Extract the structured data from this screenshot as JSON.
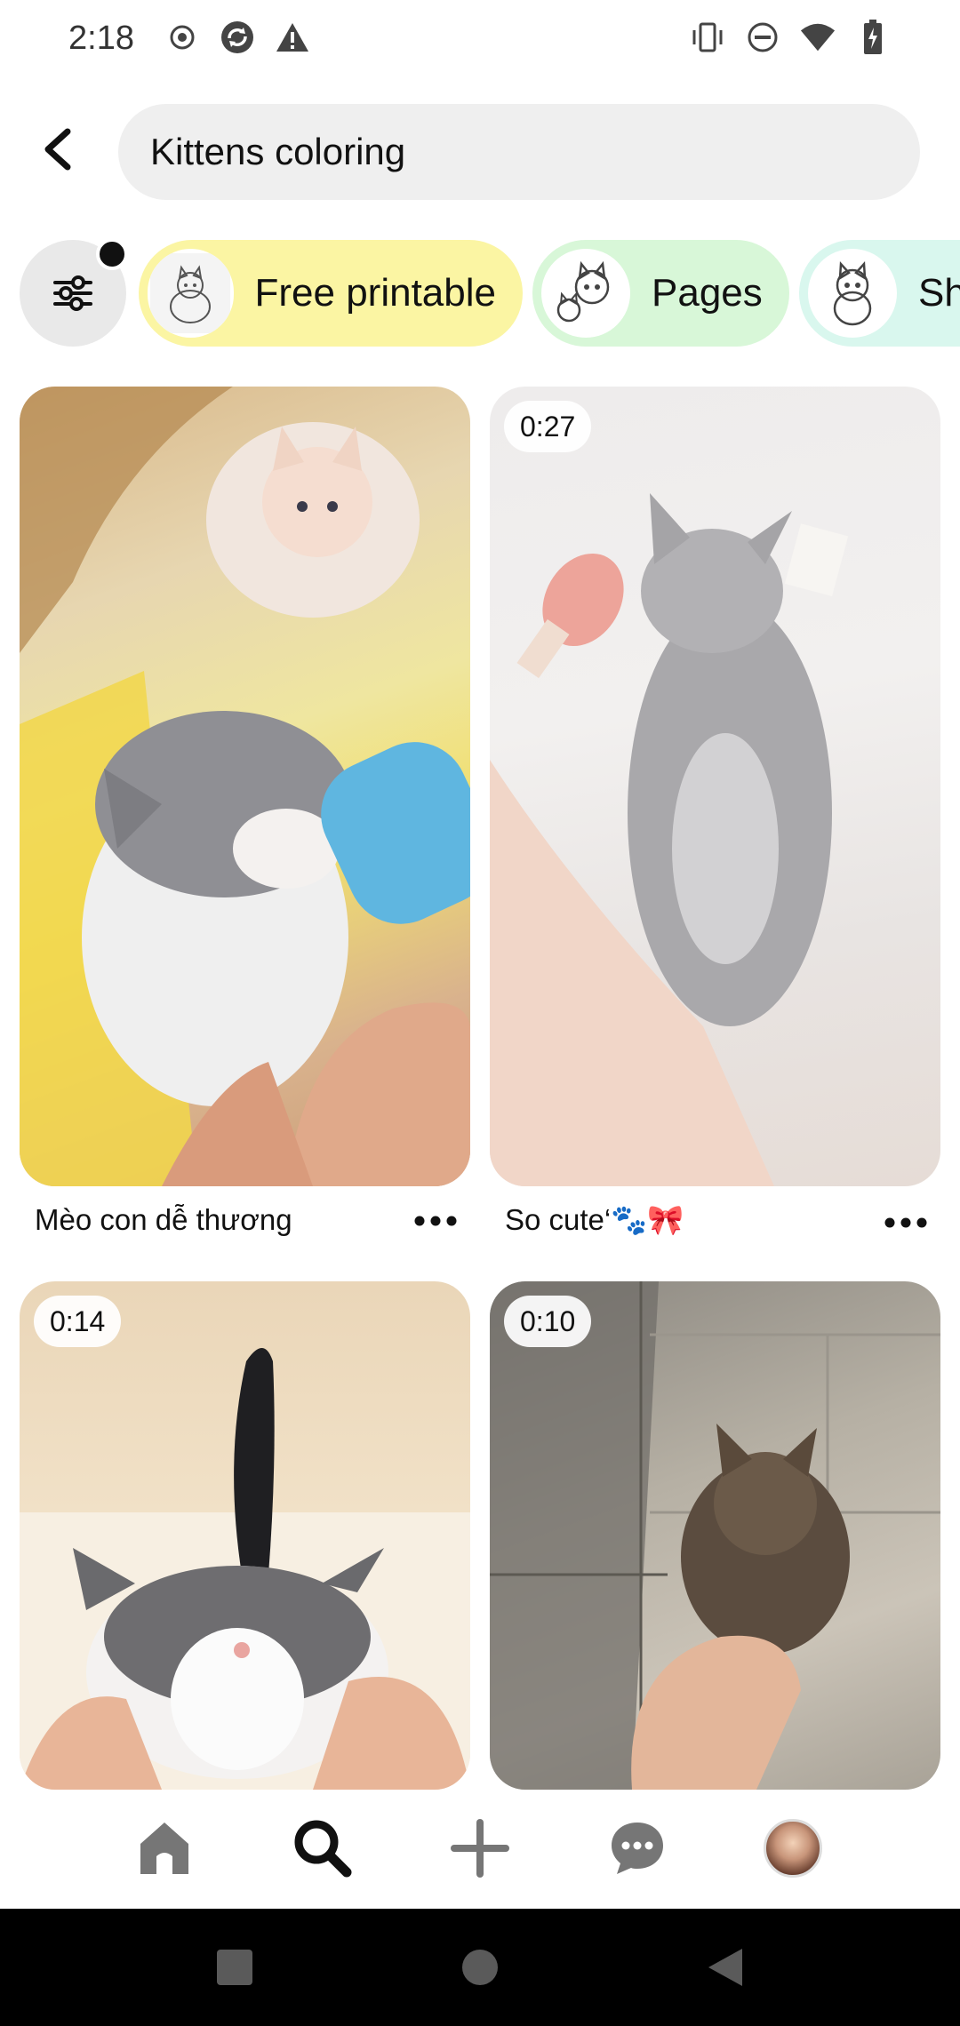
{
  "status_bar": {
    "time": "2:18",
    "left_icons": [
      "record-icon",
      "sync-icon",
      "warning-icon"
    ],
    "right_icons": [
      "vibrate-icon",
      "do-not-disturb-icon",
      "wifi-icon",
      "battery-charging-icon"
    ]
  },
  "search": {
    "query": "Kittens coloring"
  },
  "filters": {
    "has_active_dot": true,
    "chips": [
      {
        "label": "Free printable",
        "color": "#fbf5a3"
      },
      {
        "label": "Pages",
        "color": "#d8f7d8"
      },
      {
        "label": "Sh",
        "color": "#d9f7ee"
      }
    ]
  },
  "pins": [
    {
      "caption": "Mèo con dễ thương",
      "duration": null
    },
    {
      "caption": "So cute‘🐾🎀",
      "duration": "0:27"
    },
    {
      "caption": "",
      "duration": "0:14"
    },
    {
      "caption": "",
      "duration": "0:10"
    }
  ],
  "bottom_nav": {
    "items": [
      "home-icon",
      "search-icon",
      "create-icon",
      "messages-icon",
      "profile-avatar"
    ],
    "active": "search-icon"
  }
}
